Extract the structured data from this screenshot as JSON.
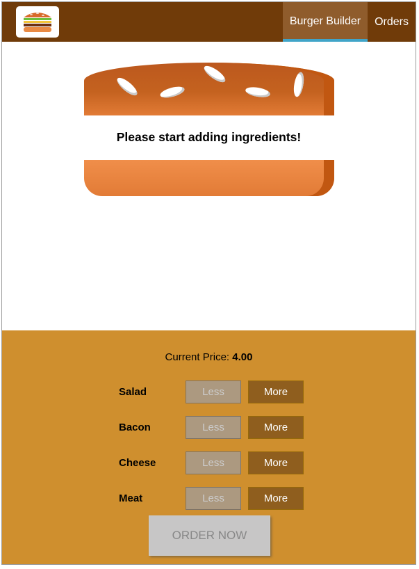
{
  "toolbar": {
    "logo_icon": "burger-logo-icon",
    "nav": [
      {
        "label": "Burger Builder",
        "active": true
      },
      {
        "label": "Orders",
        "active": false
      }
    ]
  },
  "burger": {
    "message": "Please start adding ingredients!"
  },
  "controls": {
    "price_label": "Current Price:",
    "price_value": "4.00",
    "ingredients": [
      {
        "label": "Salad",
        "less": "Less",
        "more": "More"
      },
      {
        "label": "Bacon",
        "less": "Less",
        "more": "More"
      },
      {
        "label": "Cheese",
        "less": "Less",
        "more": "More"
      },
      {
        "label": "Meat",
        "less": "Less",
        "more": "More"
      }
    ],
    "order_label": "ORDER NOW"
  },
  "colors": {
    "toolbar": "#703b09",
    "controls_bg": "#cf8f2e",
    "more_button": "#8f5e1e",
    "less_button_disabled": "#ac9980",
    "active_tab_underline": "#40a4c8"
  }
}
